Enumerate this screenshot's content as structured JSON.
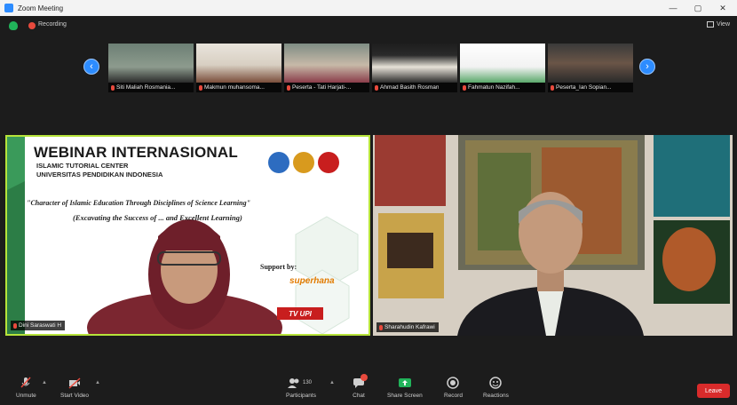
{
  "window": {
    "title": "Zoom Meeting"
  },
  "status": {
    "recording_label": "Recording",
    "view_label": "View"
  },
  "thumbnails": [
    {
      "name": "Siti Maliah Rosmania..."
    },
    {
      "name": "Makmun muhansoma..."
    },
    {
      "name": "Peserta - Tati Harjati-..."
    },
    {
      "name": "Ahmad Basith Rosman"
    },
    {
      "name": "Fahmatun Nazifah..."
    },
    {
      "name": "Peserta_Ian Sopian..."
    }
  ],
  "main": {
    "left": {
      "name": "Dini Saraswati H",
      "slide": {
        "title": "WEBINAR INTERNASIONAL",
        "sub1": "ISLAMIC TUTORIAL CENTER",
        "sub2": "UNIVERSITAS PENDIDIKAN INDONESIA",
        "theme1": "\"Character of Islamic Education Through Disciplines of Science Learning\"",
        "theme2": "(Excavating the Success of ... and Excellent Learning)",
        "support": "Support by:",
        "sponsor": "superhana",
        "tv": "TV UPI"
      }
    },
    "right": {
      "name": "Sharahudin Kafrawi"
    }
  },
  "toolbar": {
    "unmute": "Unmute",
    "start_video": "Start Video",
    "participants": "Participants",
    "participants_count": "130",
    "chat": "Chat",
    "share_screen": "Share Screen",
    "record": "Record",
    "reactions": "Reactions",
    "leave": "Leave"
  },
  "colors": {
    "accent": "#2d8cff",
    "active_speaker": "#b6e33a",
    "leave": "#d92b2b",
    "share": "#21b35a"
  }
}
